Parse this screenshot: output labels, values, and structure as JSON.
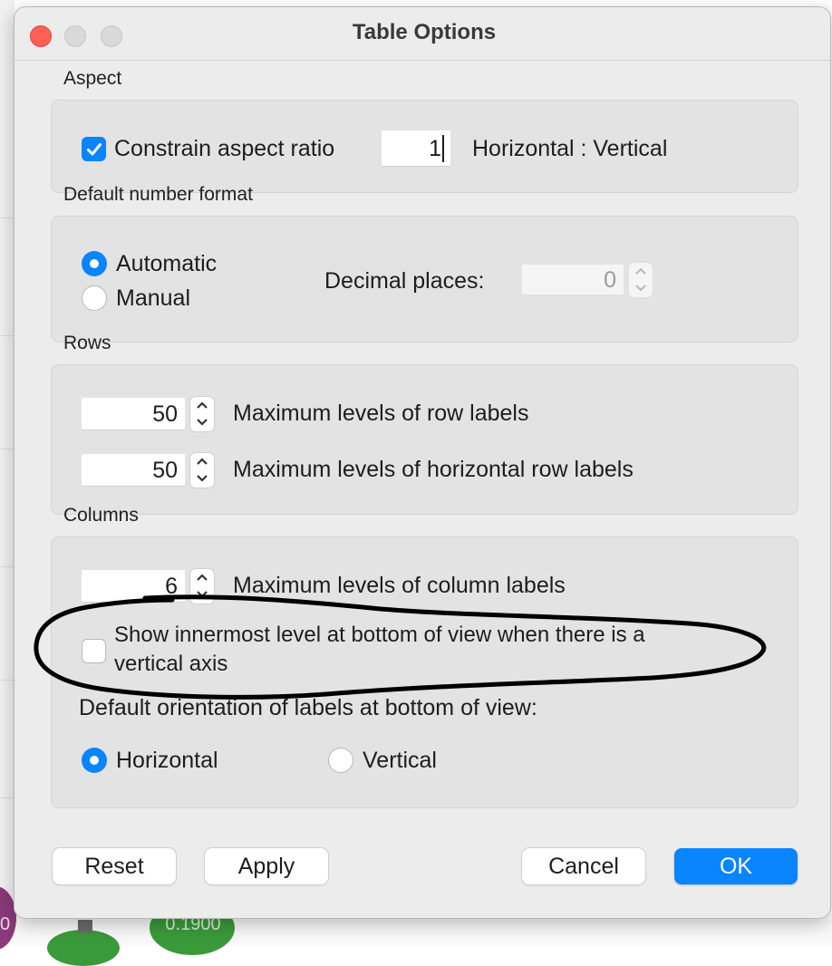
{
  "window": {
    "title": "Table Options"
  },
  "aspect": {
    "section_label": "Aspect",
    "constrain_label": "Constrain aspect ratio",
    "constrain_checked": true,
    "ratio_value": "1",
    "ratio_suffix": "Horizontal : Vertical"
  },
  "number_format": {
    "section_label": "Default number format",
    "options": [
      "Automatic",
      "Manual"
    ],
    "selected": "Automatic",
    "decimal_label": "Decimal places:",
    "decimal_value": "0"
  },
  "rows": {
    "section_label": "Rows",
    "row_labels_value": "50",
    "row_labels_text": "Maximum levels of row labels",
    "horizontal_row_labels_value": "50",
    "horizontal_row_labels_text": "Maximum levels of horizontal row labels"
  },
  "columns": {
    "section_label": "Columns",
    "column_labels_value": "6",
    "column_labels_text": "Maximum levels of column labels",
    "innermost_line1": "Show innermost level at bottom of view when there is a",
    "innermost_line2": "vertical axis",
    "innermost_checked": false,
    "orientation_label": "Default orientation of labels at bottom of view:",
    "orientation_options": [
      "Horizontal",
      "Vertical"
    ],
    "orientation_selected": "Horizontal"
  },
  "buttons": {
    "reset": "Reset",
    "apply": "Apply",
    "cancel": "Cancel",
    "ok": "OK"
  },
  "background": {
    "visible_value": "0.1900",
    "edge_value": "0"
  },
  "colors": {
    "accent": "#0a84ff",
    "annotation": "#000000",
    "bg_circle_green": "#3a9a3a",
    "bg_circle_purple": "#8a3a7a"
  },
  "icons": {
    "checkmark": "checkmark-icon",
    "stepper_up": "chevron-up-icon",
    "stepper_down": "chevron-down-icon"
  }
}
